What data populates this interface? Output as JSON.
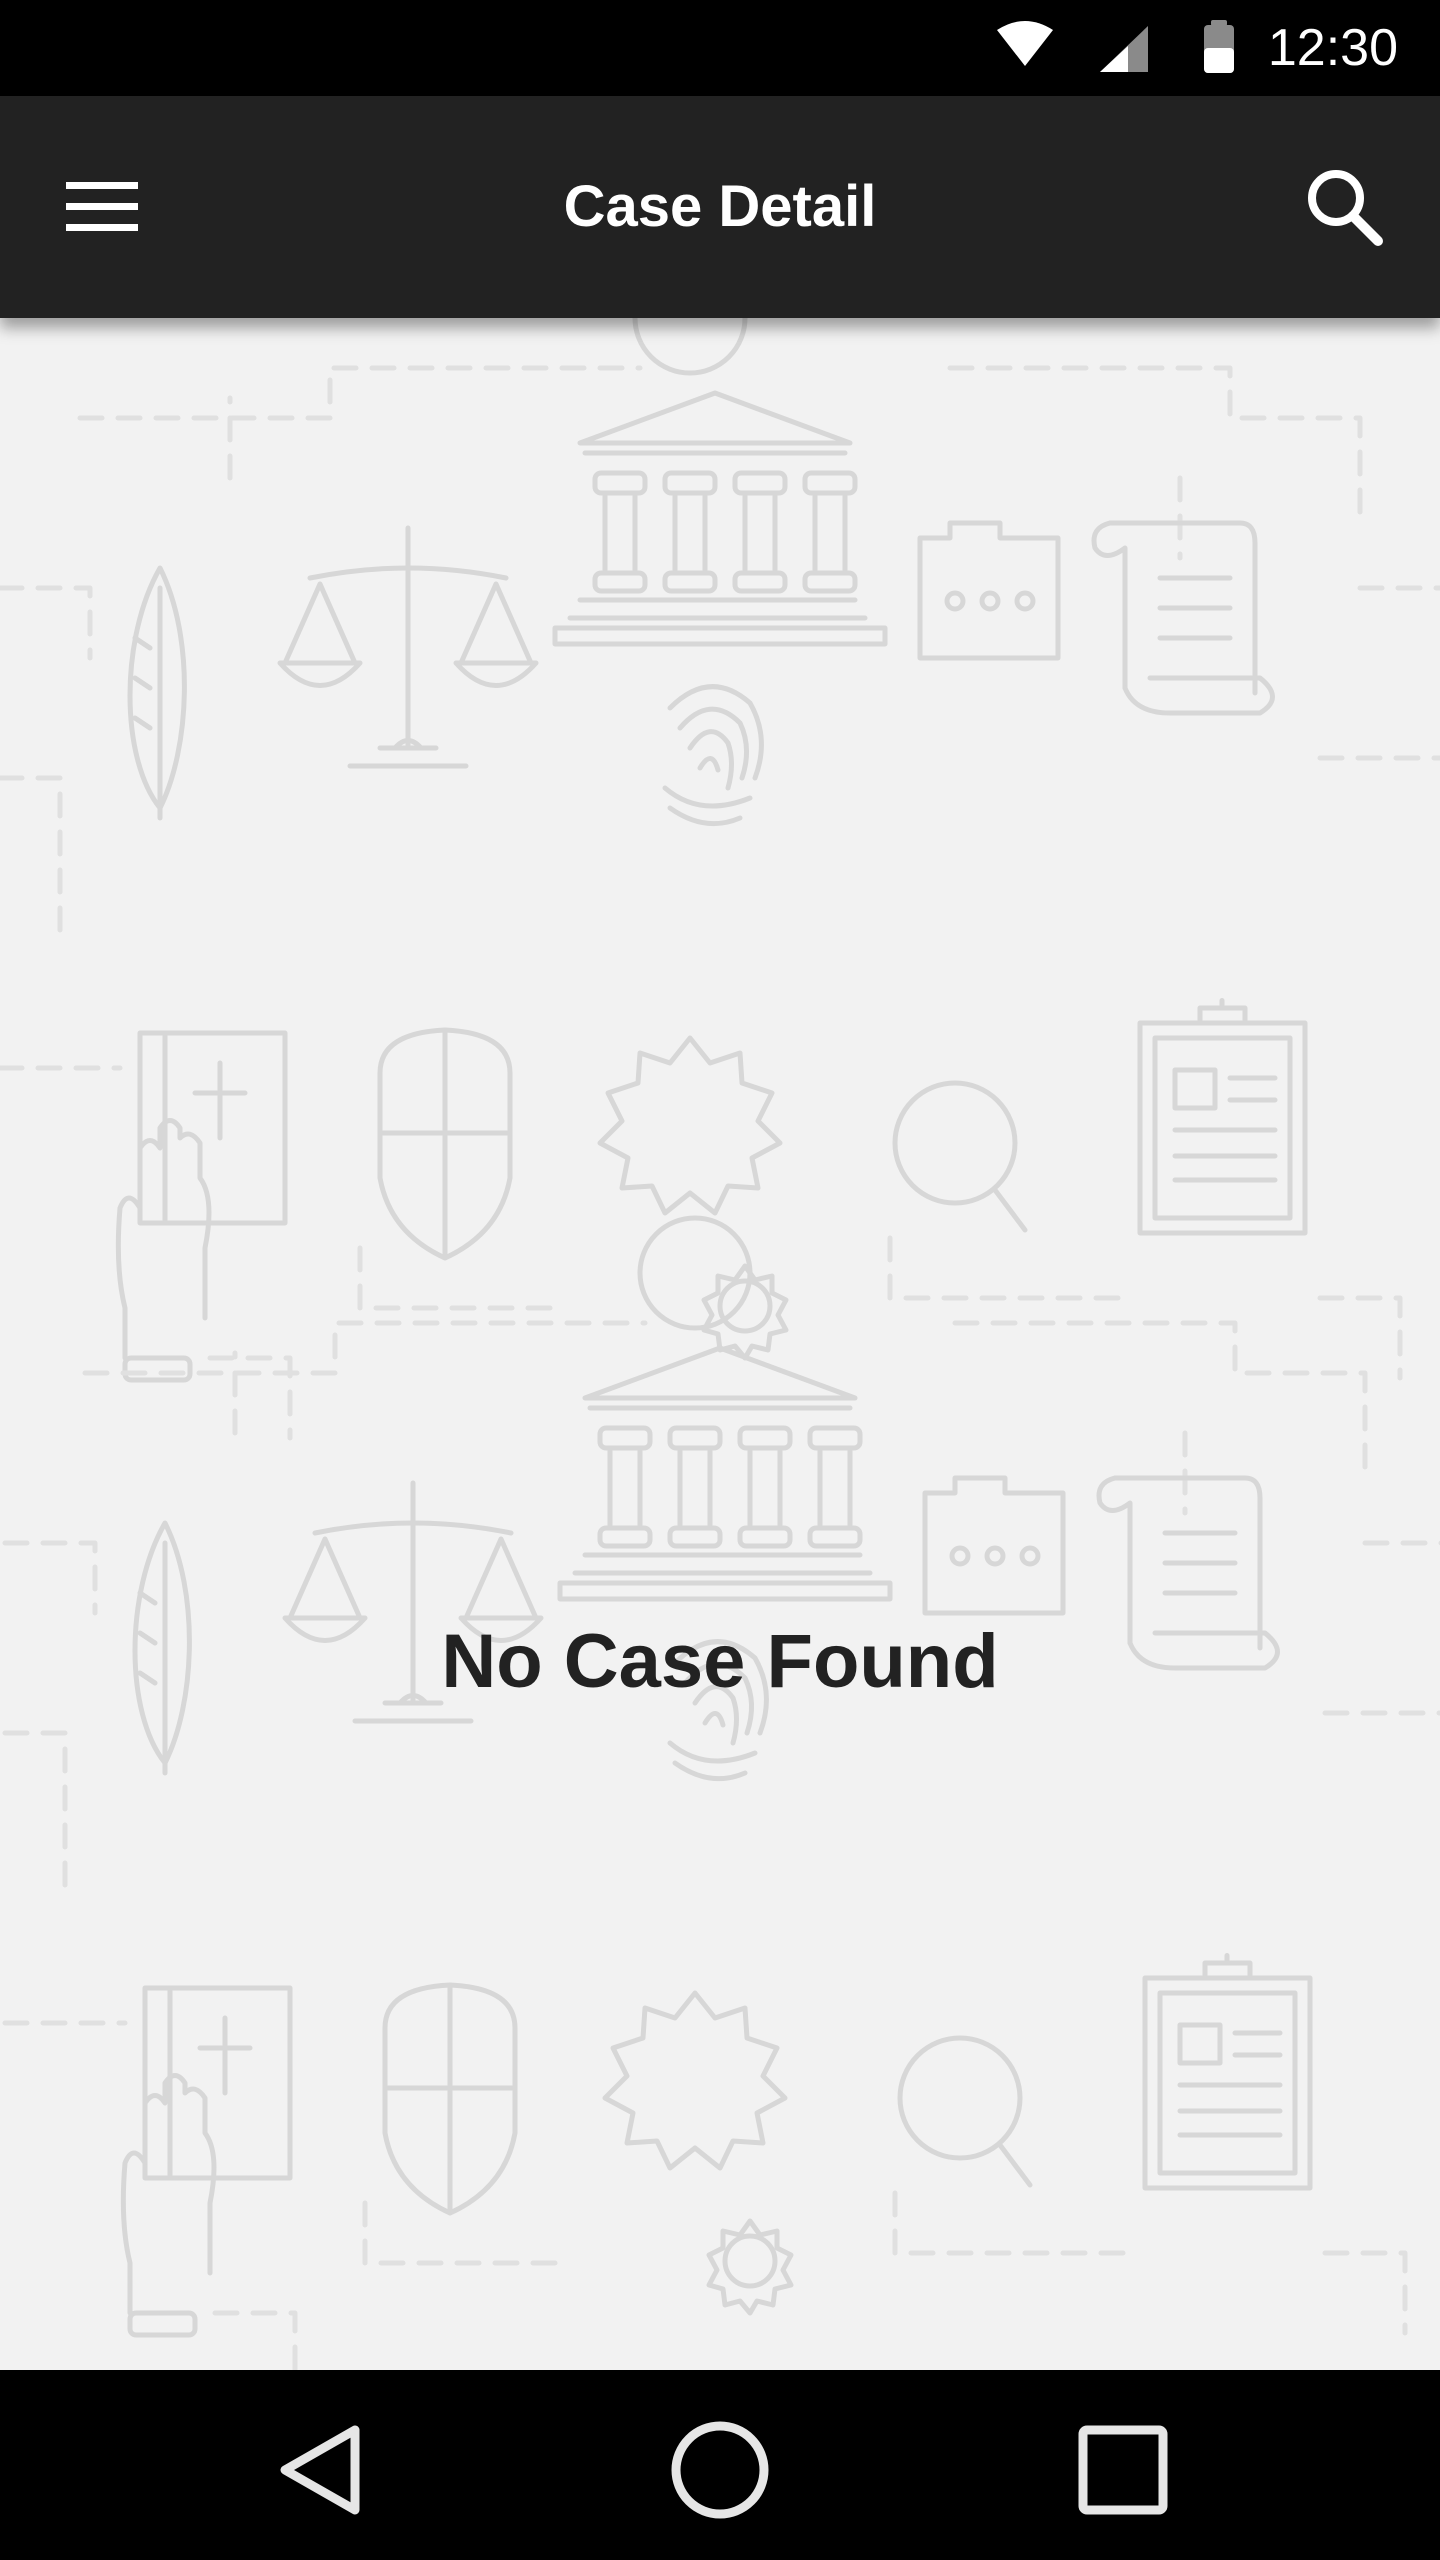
{
  "status_bar": {
    "time": "12:30",
    "icons": [
      "wifi-icon",
      "cellular-signal-icon",
      "battery-icon"
    ]
  },
  "app_bar": {
    "title": "Case Detail",
    "menu_icon": "hamburger-menu-icon",
    "search_icon": "search-icon",
    "background": "#222222"
  },
  "content": {
    "empty_message": "No Case Found",
    "background_pattern_icons": [
      "quill-icon",
      "scales-of-justice-icon",
      "courthouse-icon",
      "fingerprint-icon",
      "folder-icon",
      "scroll-icon",
      "hand-on-bible-icon",
      "shield-icon",
      "gear-icon",
      "magnifier-icon",
      "clipboard-icon"
    ]
  },
  "nav_bar": {
    "icons": [
      "back-icon",
      "home-icon",
      "recents-icon"
    ]
  },
  "colors": {
    "status_bar": "#000000",
    "app_bar": "#222222",
    "background": "#f2f2f2",
    "pattern_stroke": "#d8d8d8",
    "text": "#222222"
  }
}
